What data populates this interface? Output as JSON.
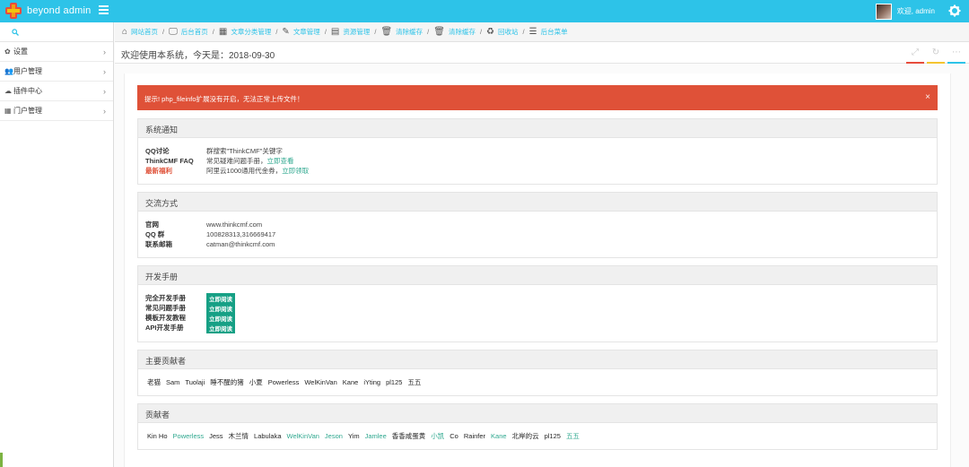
{
  "brand": {
    "name": "beyond admin"
  },
  "user": {
    "welcome": "欢迎, admin"
  },
  "sidebar": {
    "items": [
      {
        "icon": "gears-icon",
        "label": "设置"
      },
      {
        "icon": "users-icon",
        "label": "用户管理"
      },
      {
        "icon": "cloud-icon",
        "label": "插件中心"
      },
      {
        "icon": "th-icon",
        "label": "门户管理"
      }
    ]
  },
  "breadcrumb": [
    {
      "icon": "home-icon",
      "label": "网站首页"
    },
    {
      "icon": "desktop-icon",
      "label": "后台首页"
    },
    {
      "icon": "th-icon",
      "label": "文章分类管理"
    },
    {
      "icon": "pencil-icon",
      "label": "文章管理"
    },
    {
      "icon": "file-icon",
      "label": "资源管理"
    },
    {
      "icon": "trash-icon",
      "label": "清除缓存"
    },
    {
      "icon": "trash-icon",
      "label": "清除缓存"
    },
    {
      "icon": "recycle-icon",
      "label": "回收站"
    },
    {
      "icon": "list-icon",
      "label": "后台菜单"
    }
  ],
  "page": {
    "title": "欢迎使用本系统，今天是：2018-09-30"
  },
  "header_tools": {
    "colors": [
      "#e74c3c",
      "#f4c430",
      "#2dc3e8"
    ]
  },
  "alert": {
    "text": "提示! php_fileinfo扩展没有开启，无法正常上传文件！",
    "close": "×"
  },
  "panels": {
    "notice": {
      "title": "系统通知",
      "rows": [
        {
          "k": "QQ讨论",
          "v": "群搜索\"ThinkCMF\"关键字",
          "link": ""
        },
        {
          "k": "ThinkCMF FAQ",
          "v": "常见疑难问题手册，",
          "link": "立即查看"
        },
        {
          "k": "最新福利",
          "v": "阿里云1000通用代金券，",
          "link": "立即领取"
        }
      ]
    },
    "contact": {
      "title": "交流方式",
      "rows": [
        {
          "k": "官网",
          "v": "www.thinkcmf.com"
        },
        {
          "k": "QQ 群",
          "v": "100828313,316669417"
        },
        {
          "k": "联系邮箱",
          "v": "catman@thinkcmf.com"
        }
      ]
    },
    "docs": {
      "title": "开发手册",
      "rows": [
        {
          "k": "完全开发手册",
          "tag": "立即阅读"
        },
        {
          "k": "常见问题手册",
          "tag": "立即阅读"
        },
        {
          "k": "模板开发教程",
          "tag": "立即阅读"
        },
        {
          "k": "API开发手册",
          "tag": "立即阅读"
        }
      ]
    },
    "main_contributors": {
      "title": "主要贡献者",
      "names": [
        "老猫",
        "Sam",
        "Tuolaji",
        "睡不醒的猪",
        "小夏",
        "Powerless",
        "WelKinVan",
        "Kane",
        "iYting",
        "pl125",
        "五五"
      ]
    },
    "contributors": {
      "title": "贡献者",
      "names": [
        "Kin Ho",
        "Powerless",
        "Jess",
        "木兰情",
        "Labulaka",
        "WelKinVan",
        "Jeson",
        "Yim",
        "Jamlee",
        "香香咸蛋黄",
        "小凯",
        "Co",
        "Rainfer",
        "Kane",
        "北岸的云",
        "pl125",
        "五五"
      ]
    }
  }
}
